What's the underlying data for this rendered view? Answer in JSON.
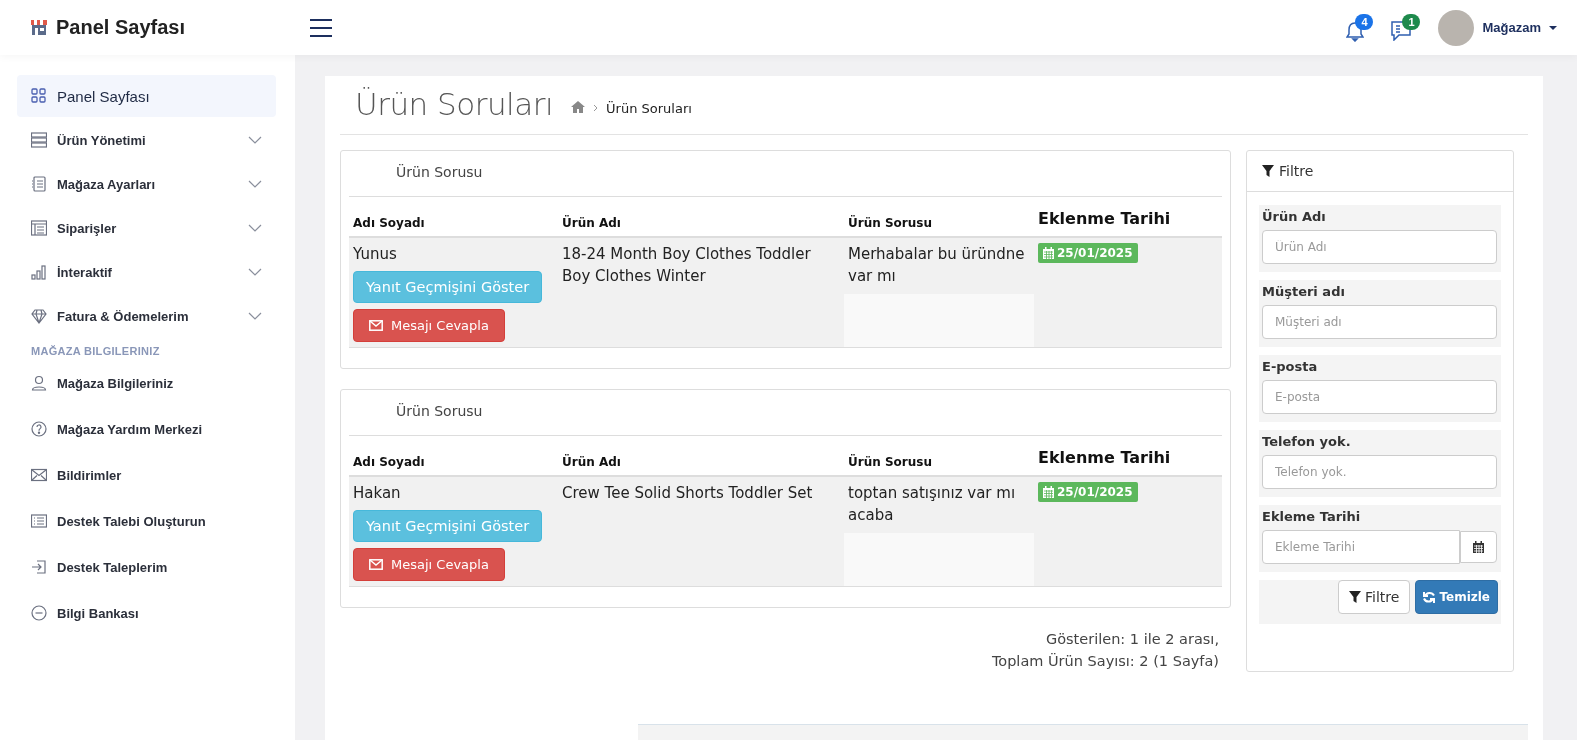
{
  "header": {
    "brand": "Panel Sayfası",
    "notifications": {
      "count": "4"
    },
    "messages": {
      "count": "1"
    },
    "user": {
      "name": "Mağazam"
    }
  },
  "sidebar": {
    "items": [
      {
        "label": "Panel Sayfası",
        "kind": "grid",
        "selected": true,
        "expandable": false
      },
      {
        "label": "Ürün Yönetimi",
        "kind": "stack",
        "selected": false,
        "expandable": true
      },
      {
        "label": "Mağaza Ayarları",
        "kind": "form",
        "selected": false,
        "expandable": true
      },
      {
        "label": "Siparişler",
        "kind": "table",
        "selected": false,
        "expandable": true
      },
      {
        "label": "İnteraktif",
        "kind": "chart",
        "selected": false,
        "expandable": true
      },
      {
        "label": "Fatura & Ödemelerim",
        "kind": "diamond",
        "selected": false,
        "expandable": true
      }
    ],
    "section_title": "MAĞAZA BILGILERINIZ",
    "section_items": [
      {
        "label": "Mağaza Bilgileriniz",
        "kind": "user",
        "selected": false,
        "expandable": false
      },
      {
        "label": "Mağaza Yardım Merkezi",
        "kind": "help",
        "selected": false,
        "expandable": false
      },
      {
        "label": "Bildirimler",
        "kind": "mail",
        "selected": false,
        "expandable": false
      },
      {
        "label": "Destek Talebi Oluşturun",
        "kind": "lines",
        "selected": false,
        "expandable": false
      },
      {
        "label": "Destek Taleplerim",
        "kind": "login",
        "selected": false,
        "expandable": false
      },
      {
        "label": "Bilgi Bankası",
        "kind": "minus",
        "selected": false,
        "expandable": false
      }
    ]
  },
  "page": {
    "title": "Ürün Soruları",
    "breadcrumb": "Ürün Soruları"
  },
  "questions": [
    {
      "card_title": "Ürün Sorusu",
      "columns": [
        "Adı Soyadı",
        "Ürün Adı",
        "Ürün Sorusu",
        "Eklenme Tarihi"
      ],
      "name": "Yunus",
      "history_button": "Yanıt Geçmişini Göster",
      "reply_button": "Mesajı Cevapla",
      "product": "18-24 Month Boy Clothes Toddler Boy Clothes Winter",
      "question": "Merhabalar bu üründne var mı",
      "date": "25/01/2025"
    },
    {
      "card_title": "Ürün Sorusu",
      "columns": [
        "Adı Soyadı",
        "Ürün Adı",
        "Ürün Sorusu",
        "Eklenme Tarihi"
      ],
      "name": "Hakan",
      "history_button": "Yanıt Geçmişini Göster",
      "reply_button": "Mesajı Cevapla",
      "product": "Crew Tee Solid Shorts Toddler Set",
      "question": "toptan satışınız var mı acaba",
      "date": "25/01/2025"
    }
  ],
  "pagination": {
    "showing": "Gösterilen: 1 ile 2 arası,",
    "total": "Toplam Ürün Sayısı: 2 (1 Sayfa)"
  },
  "filter": {
    "title": "Filtre",
    "fields": [
      {
        "label": "Ürün Adı",
        "placeholder": "Ürün Adı",
        "kind": "text"
      },
      {
        "label": "Müşteri adı",
        "placeholder": "Müşteri adı",
        "kind": "text"
      },
      {
        "label": "E-posta",
        "placeholder": "E-posta",
        "kind": "text"
      },
      {
        "label": "Telefon yok.",
        "placeholder": "Telefon yok.",
        "kind": "text"
      },
      {
        "label": "Ekleme Tarihi",
        "placeholder": "Ekleme Tarihi",
        "kind": "date"
      }
    ],
    "filter_button": "Filtre",
    "clear_button": "Temizle"
  }
}
